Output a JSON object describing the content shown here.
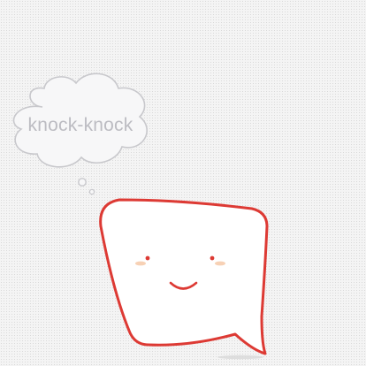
{
  "thought_bubble": {
    "text": "knock-knock"
  },
  "colors": {
    "bubble_outline": "#c8c8cc",
    "thought_text": "#bcbcc2",
    "speech_outline": "#dd3a34",
    "speech_fill": "#ffffff",
    "eyes": "#dd3a34",
    "mouth": "#dd3a34",
    "cheeks": "#f6c9a8",
    "shadow": "#d8d8d8"
  },
  "character": {
    "expression": "smile"
  }
}
